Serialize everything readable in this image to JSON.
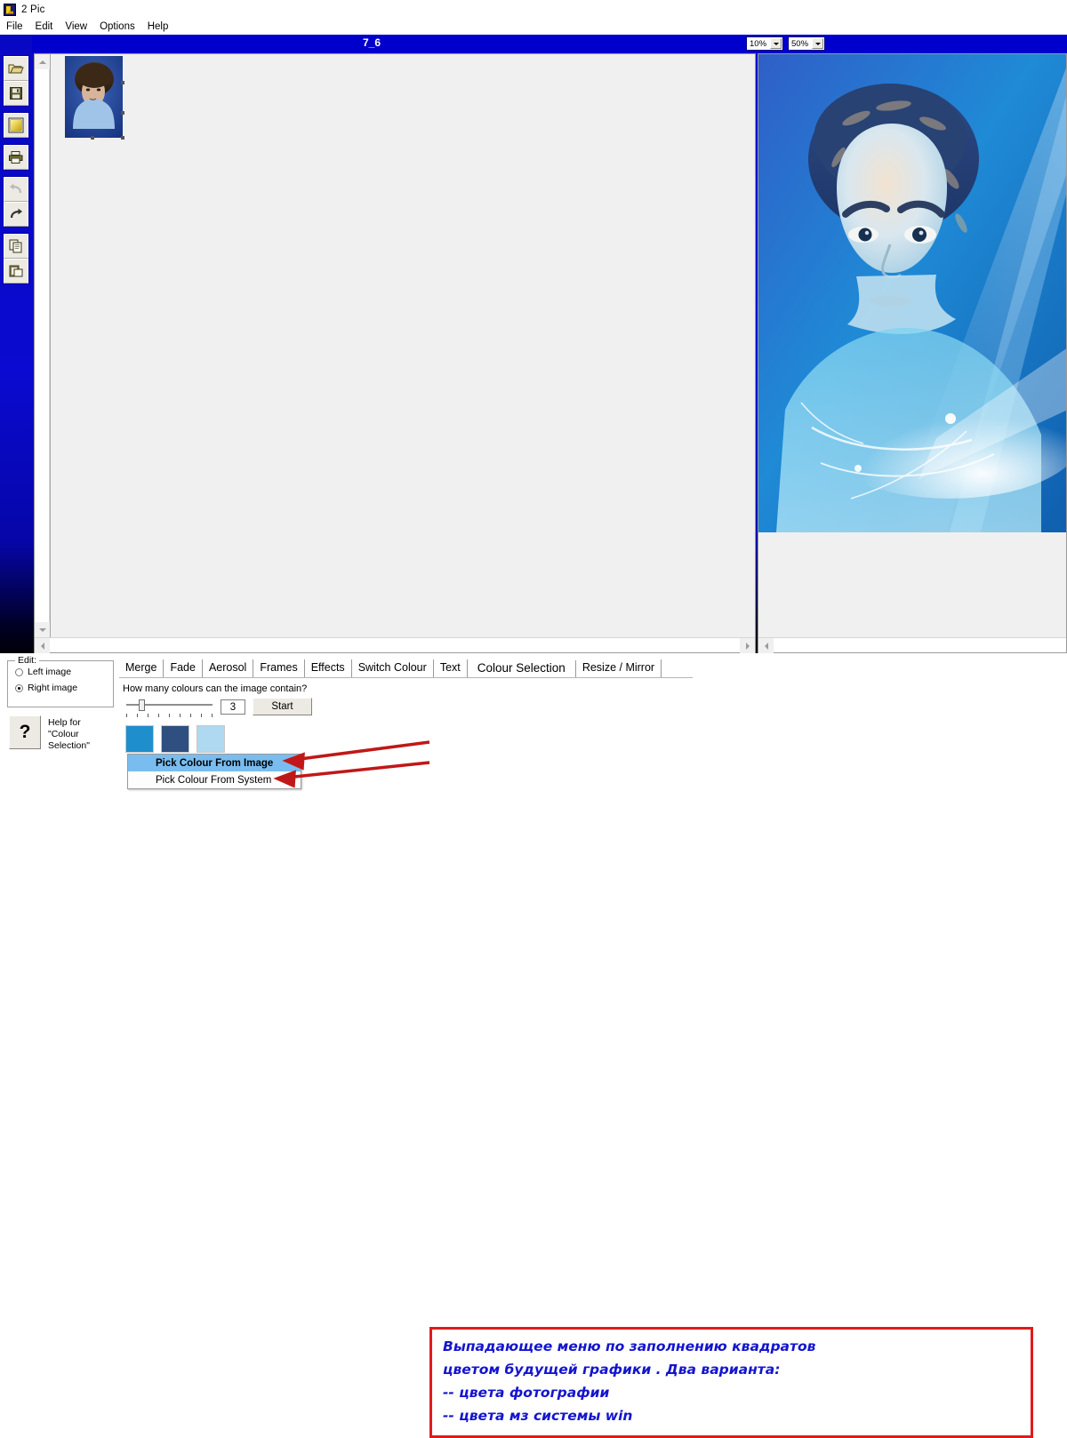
{
  "window": {
    "title": "2 Pic",
    "icon": "app-icon"
  },
  "menubar": {
    "items": [
      {
        "label": "File"
      },
      {
        "label": "Edit"
      },
      {
        "label": "View"
      },
      {
        "label": "Options"
      },
      {
        "label": "Help"
      }
    ]
  },
  "toolbar": {
    "buttons": [
      {
        "icon": "open-folder-icon",
        "label": "Open"
      },
      {
        "icon": "save-disk-icon",
        "label": "Save"
      },
      {
        "icon": "colour-gradient-icon",
        "label": "Colour"
      },
      {
        "icon": "print-icon",
        "label": "Print"
      },
      {
        "icon": "undo-icon",
        "label": "Undo",
        "disabled": true
      },
      {
        "icon": "redo-icon",
        "label": "Redo",
        "disabled": false
      },
      {
        "icon": "copy-icon",
        "label": "Copy"
      },
      {
        "icon": "paste-icon",
        "label": "Paste"
      }
    ]
  },
  "document": {
    "title": "7_6",
    "zoom_left": "10%",
    "zoom_right": "50%"
  },
  "edit_group": {
    "legend": "Edit:",
    "options": [
      {
        "label": "Left image",
        "selected": false
      },
      {
        "label": "Right image",
        "selected": true
      }
    ]
  },
  "help": {
    "glyph": "?",
    "label": "Help for \"Colour Selection\""
  },
  "tabs": [
    {
      "label": "Merge",
      "active": false
    },
    {
      "label": "Fade",
      "active": false
    },
    {
      "label": "Aerosol",
      "active": false
    },
    {
      "label": "Frames",
      "active": false
    },
    {
      "label": "Effects",
      "active": false
    },
    {
      "label": "Switch Colour",
      "active": false
    },
    {
      "label": "Text",
      "active": false
    },
    {
      "label": "Colour Selection",
      "active": true
    },
    {
      "label": "Resize / Mirror",
      "active": false
    }
  ],
  "colour_selection": {
    "question": "How many colours can the image contain?",
    "count_value": "3",
    "start_label": "Start",
    "swatches": [
      "#1f8ecd",
      "#2e4f80",
      "#aed9f0"
    ]
  },
  "dropdown": {
    "items": [
      {
        "label": "Pick Colour From Image",
        "selected": true
      },
      {
        "label": "Pick Colour From System",
        "selected": false
      }
    ]
  },
  "annotation": {
    "border_color": "#e01b1b",
    "text_color": "#1414cf",
    "lines": [
      "Выпадающее меню по заполнению квадратов",
      "цветом будущей графики . Два варианта:",
      "-- цвета фотографии",
      "-- цвета мз системы win"
    ]
  }
}
